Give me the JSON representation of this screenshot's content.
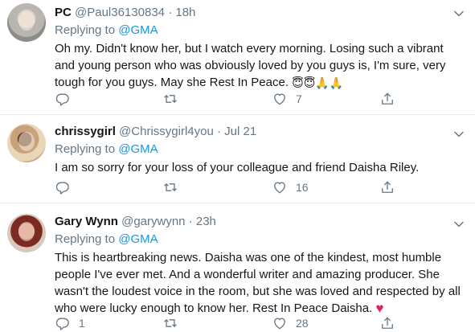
{
  "colors": {
    "accent": "#1b95e0",
    "text": "#14171a",
    "muted": "#657786",
    "divider": "#e6ecf0",
    "heart": "#e0245e"
  },
  "tweets": [
    {
      "name": "PC",
      "handle": "@Paul36130834",
      "separator": "·",
      "time": "18h",
      "replying_prefix": "Replying to",
      "replying_to": "@GMA",
      "body": "Oh my. Didn't know her, but I watch every morning. Losing such a vibrant and young person who was obviously loved by you guys is, I'm sure, very tough for you guys. May she Rest In Peace.",
      "emojis": "😇😇🙏🙏",
      "reply_count": "",
      "retweet_count": "",
      "like_count": "7"
    },
    {
      "name": "chrissygirl",
      "handle": "@Chrissygirl4you",
      "separator": "·",
      "time": "Jul 21",
      "replying_prefix": "Replying to",
      "replying_to": "@GMA",
      "body": "I am so sorry for your loss of your colleague and friend Daisha Riley.",
      "reply_count": "",
      "retweet_count": "",
      "like_count": "16"
    },
    {
      "name": "Gary Wynn",
      "handle": "@garywynn",
      "separator": "·",
      "time": "23h",
      "replying_prefix": "Replying to",
      "replying_to": "@GMA",
      "body": "This is heartbreaking news. Daisha was one of the kindest, most humble people I've ever met. And a wonderful writer and amazing producer. She wasn't the loudest voice in the room, but she was loved and respected by all who were lucky enough to know her. Rest In Peace Daisha.",
      "emojis": "♥",
      "reply_count": "1",
      "retweet_count": "",
      "like_count": "28"
    }
  ]
}
